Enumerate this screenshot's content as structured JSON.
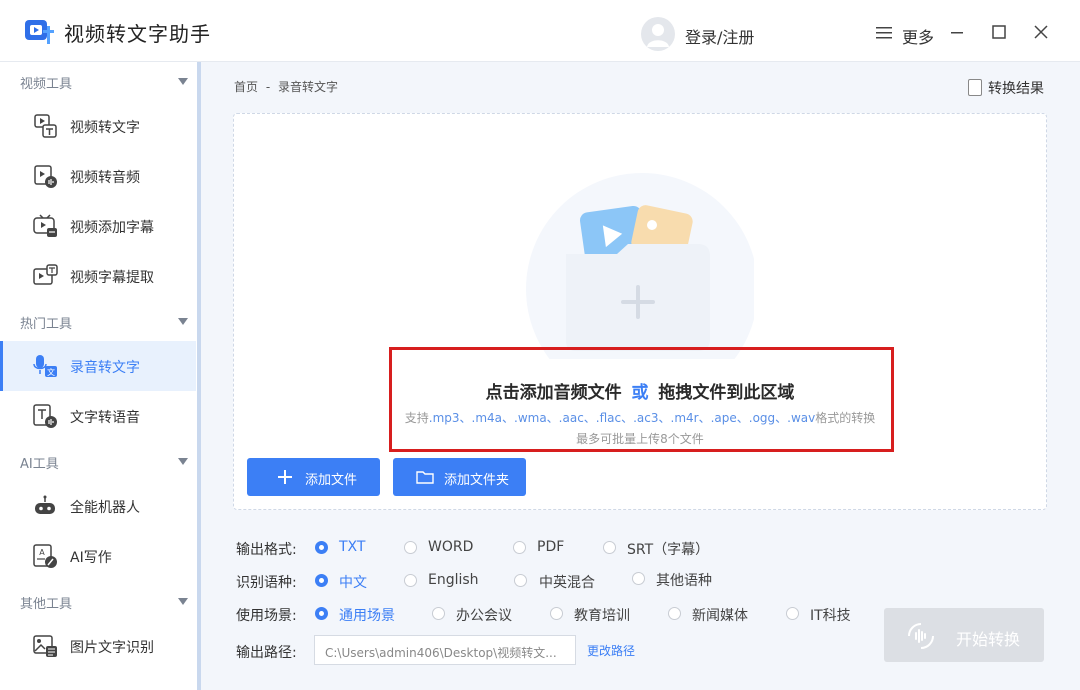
{
  "app": {
    "title": "视频转文字助手"
  },
  "header": {
    "login": "登录/注册",
    "more": "更多"
  },
  "sidebar": {
    "groups": [
      {
        "label": "视频工具"
      },
      {
        "label": "热门工具"
      },
      {
        "label": "AI工具"
      },
      {
        "label": "其他工具"
      }
    ],
    "items": [
      {
        "label": "视频转文字",
        "icon": "video-to-text-icon"
      },
      {
        "label": "视频转音频",
        "icon": "video-to-audio-icon"
      },
      {
        "label": "视频添加字幕",
        "icon": "add-subtitle-icon"
      },
      {
        "label": "视频字幕提取",
        "icon": "subtitle-extract-icon"
      },
      {
        "label": "录音转文字",
        "icon": "audio-to-text-icon",
        "active": true
      },
      {
        "label": "文字转语音",
        "icon": "text-to-speech-icon"
      },
      {
        "label": "全能机器人",
        "icon": "robot-icon"
      },
      {
        "label": "AI写作",
        "icon": "ai-writing-icon"
      },
      {
        "label": "图片文字识别",
        "icon": "image-ocr-icon"
      }
    ]
  },
  "breadcrumb": {
    "home": "首页",
    "sep": "-",
    "current": "录音转文字"
  },
  "result_link": "转换结果",
  "dropzone": {
    "main_prefix": "点击添加音频文件",
    "main_or": "或",
    "main_suffix": "拖拽文件到此区域",
    "formats_prefix": "支持",
    "formats": ".mp3、.m4a、.wma、.aac、.flac、.ac3、.m4r、.ape、.ogg、.wav",
    "formats_suffix": "格式的转换",
    "limit": "最多可批量上传8个文件"
  },
  "buttons": {
    "add_file": "添加文件",
    "add_folder": "添加文件夹",
    "start": "开始转换",
    "change_path": "更改路径"
  },
  "options": {
    "format": {
      "label": "输出格式:",
      "choices": [
        "TXT",
        "WORD",
        "PDF",
        "SRT（字幕）"
      ],
      "selected": "TXT"
    },
    "language": {
      "label": "识别语种:",
      "choices": [
        "中文",
        "English",
        "中英混合",
        "其他语种"
      ],
      "selected": "中文"
    },
    "scene": {
      "label": "使用场景:",
      "choices": [
        "通用场景",
        "办公会议",
        "教育培训",
        "新闻媒体",
        "IT科技"
      ],
      "selected": "通用场景"
    },
    "path": {
      "label": "输出路径:",
      "value": "C:\\Users\\admin406\\Desktop\\视频转文..."
    }
  },
  "colors": {
    "accent": "#3c7ff5",
    "highlight": "#d71e1e"
  }
}
